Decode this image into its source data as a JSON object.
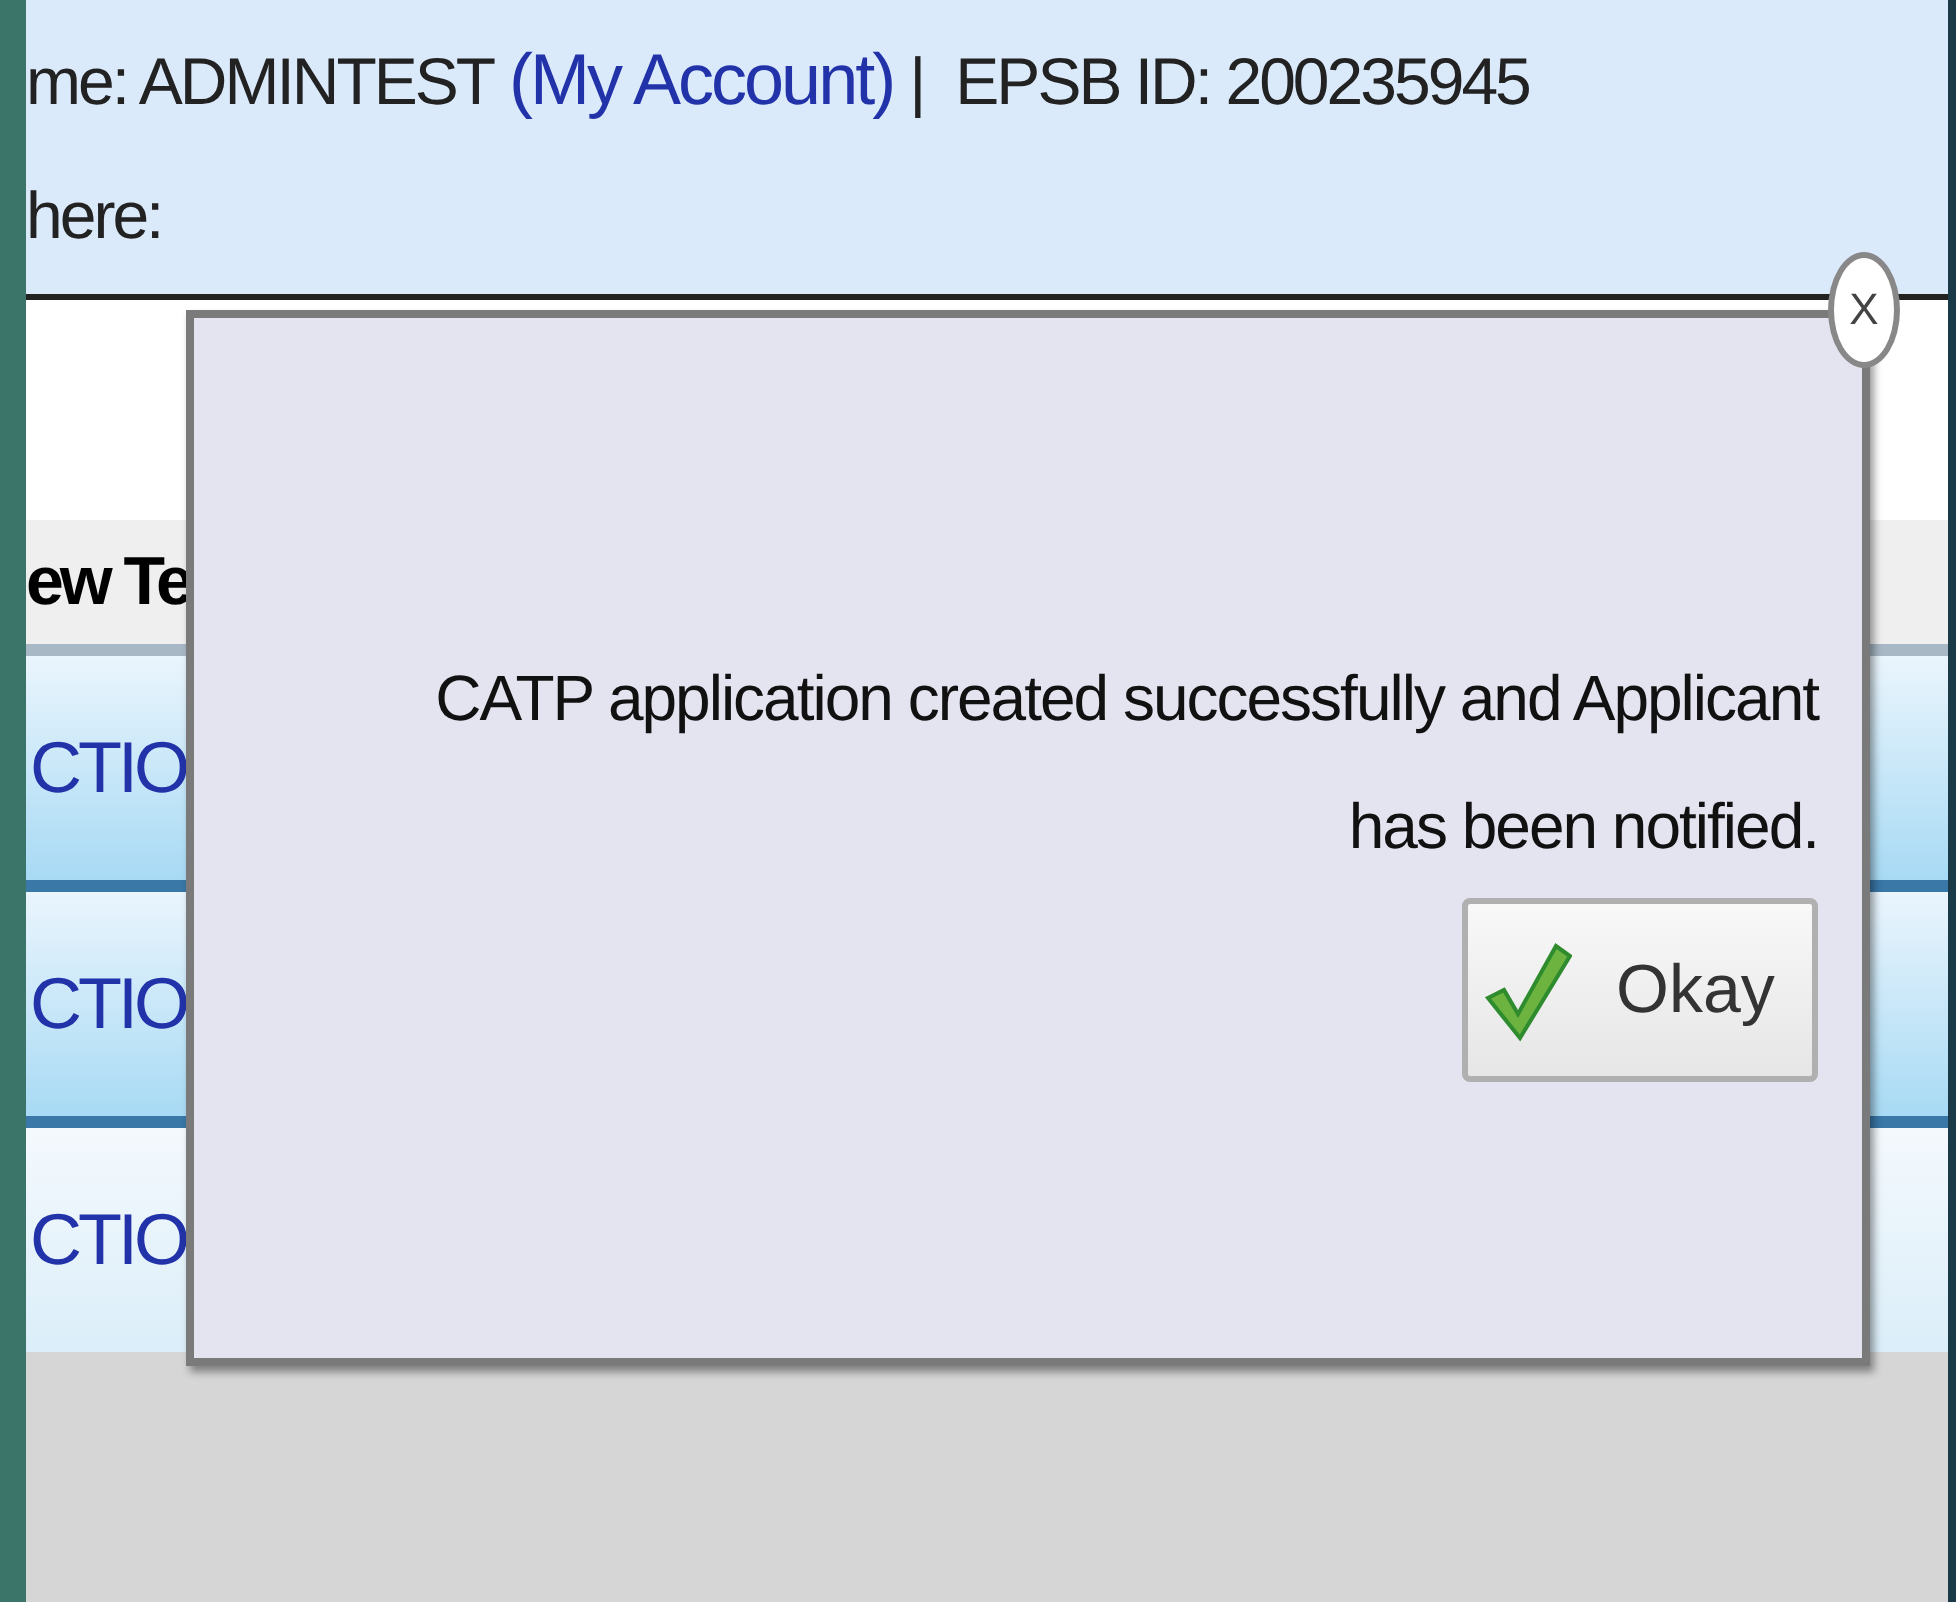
{
  "header": {
    "user_label": "me: ADMINTEST",
    "account_link": "(My Account)",
    "separator": "|",
    "id_label": "EPSB ID: 200235945",
    "prompt": "here:"
  },
  "table": {
    "column_1": "ew Te",
    "rows": [
      {
        "cell": "CTIO",
        "selected": true
      },
      {
        "cell": "CTIO",
        "selected": true
      },
      {
        "cell": "CTIO",
        "selected": false
      }
    ]
  },
  "dialog": {
    "close": "X",
    "message": "CATP application created successfully and Applicant has been notified.",
    "button": "Okay"
  }
}
